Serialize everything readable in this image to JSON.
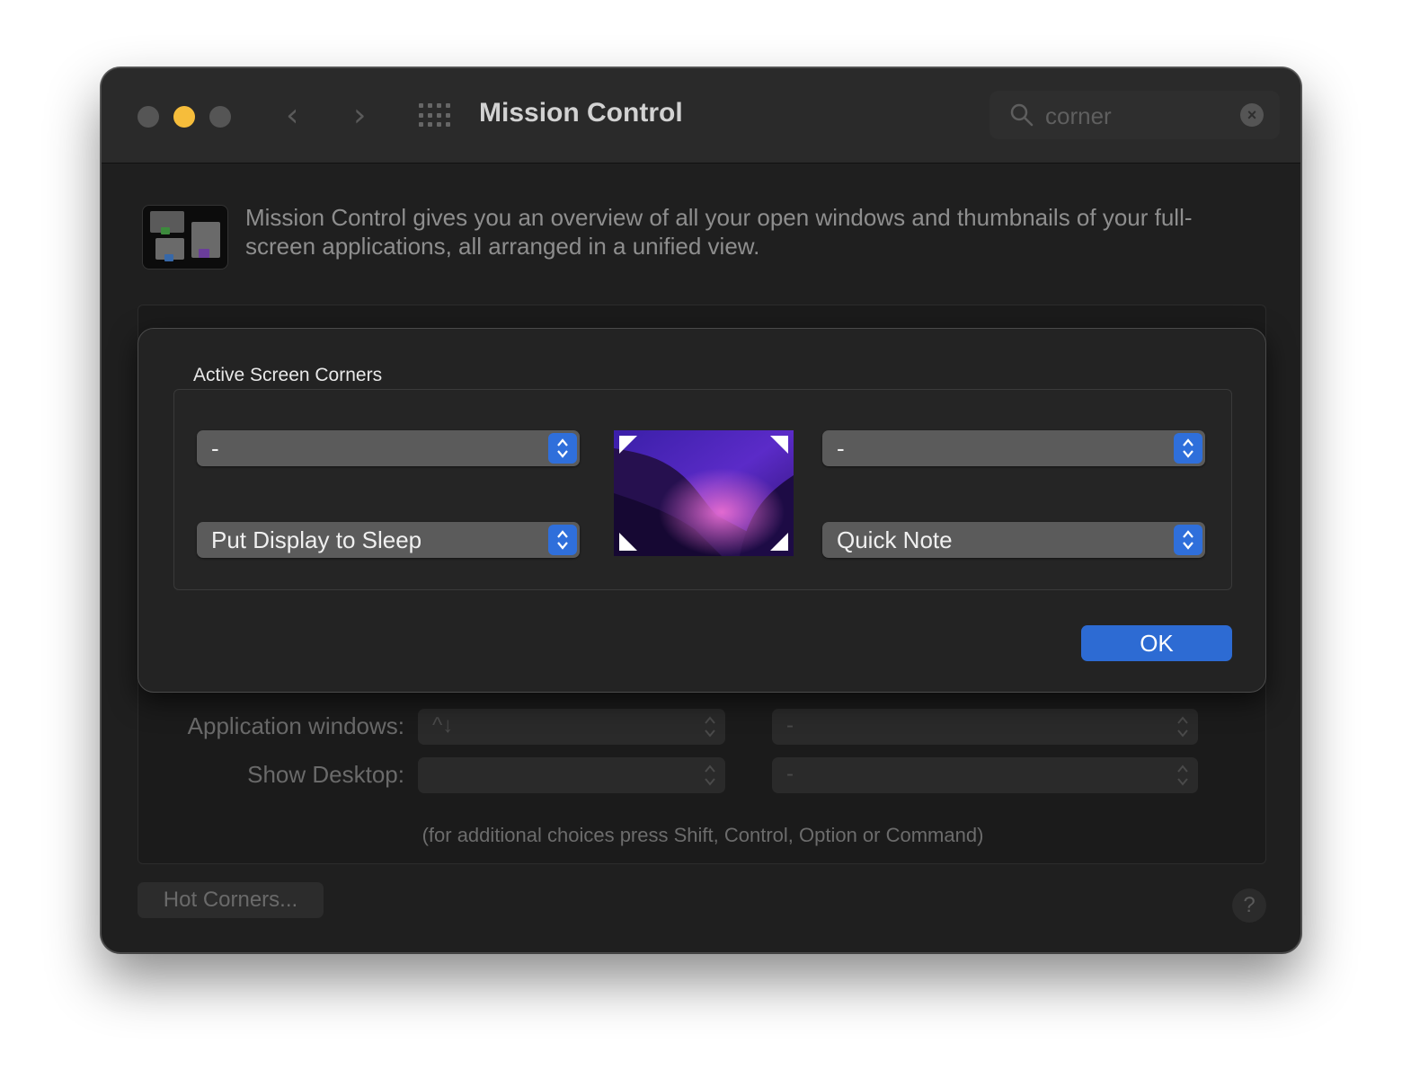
{
  "window": {
    "title": "Mission Control"
  },
  "toolbar": {
    "back_icon": "chevron-left-icon",
    "forward_icon": "chevron-right-icon",
    "show_all_icon": "grid-icon"
  },
  "search": {
    "value": "corner",
    "icon": "search-icon",
    "clear_icon": "clear-icon"
  },
  "header": {
    "description": "Mission Control gives you an overview of all your open windows and thumbnails of your full-screen applications, all arranged in a unified view."
  },
  "background_settings": {
    "rows": [
      {
        "label": "Application windows:",
        "key_value": "^↓",
        "mouse_value": "-"
      },
      {
        "label": "Show Desktop:",
        "key_value": "",
        "mouse_value": "-"
      }
    ],
    "hint": "(for additional choices press Shift, Control, Option or Command)",
    "hot_corners_label": "Hot Corners...",
    "help_label": "?"
  },
  "sheet": {
    "title": "Active Screen Corners",
    "top_left": "-",
    "top_right": "-",
    "bottom_left": "Put Display to Sleep",
    "bottom_right": "Quick Note",
    "ok_label": "OK"
  },
  "colors": {
    "accent": "#2d6bd3",
    "minimize": "#f6bd3b",
    "window_bg": "#1f1f1f"
  }
}
